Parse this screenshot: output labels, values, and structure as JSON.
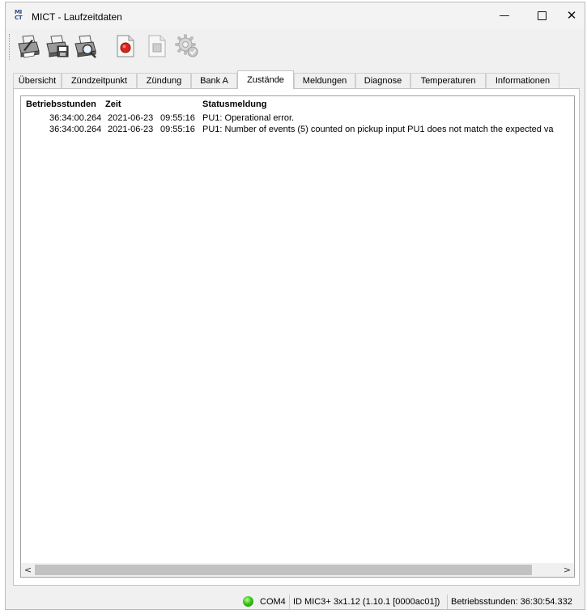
{
  "window": {
    "title": "MICT - Laufzeitdaten",
    "app_icon_text_top": "MI",
    "app_icon_text_bottom": "CT",
    "min_glyph": "—",
    "close_glyph": "✕"
  },
  "toolbar": {
    "buttons": [
      {
        "icon": "printer-icon"
      },
      {
        "icon": "print-save-icon"
      },
      {
        "icon": "print-preview-icon"
      },
      {
        "icon": "record-icon"
      },
      {
        "icon": "stop-icon"
      },
      {
        "icon": "settings-gear-icon"
      }
    ]
  },
  "tabs": [
    {
      "label": "Übersicht"
    },
    {
      "label": "Zündzeitpunkt"
    },
    {
      "label": "Zündung"
    },
    {
      "label": "Bank A"
    },
    {
      "label": "Zustände",
      "active": true
    },
    {
      "label": "Meldungen"
    },
    {
      "label": "Diagnose"
    },
    {
      "label": "Temperaturen"
    },
    {
      "label": "Informationen"
    }
  ],
  "list": {
    "columns": [
      "Betriebsstunden",
      "Zeit",
      "Statusmeldung"
    ],
    "rows": [
      {
        "hours": "36:34:00.264",
        "date": "2021-06-23",
        "time": "09:55:16",
        "message": "PU1: Operational error."
      },
      {
        "hours": "36:34:00.264",
        "date": "2021-06-23",
        "time": "09:55:16",
        "message": "PU1: Number of events (5) counted on pickup input PU1 does not match the expected va"
      }
    ],
    "scroll_left": "<",
    "scroll_right": ">"
  },
  "status": {
    "connection_color": "#36c21a",
    "port": "COM4",
    "device_id": "ID MIC3+ 3x1.12 (1.10.1 [0000ac01])",
    "operating_hours": "Betriebsstunden: 36:30:54.332"
  }
}
